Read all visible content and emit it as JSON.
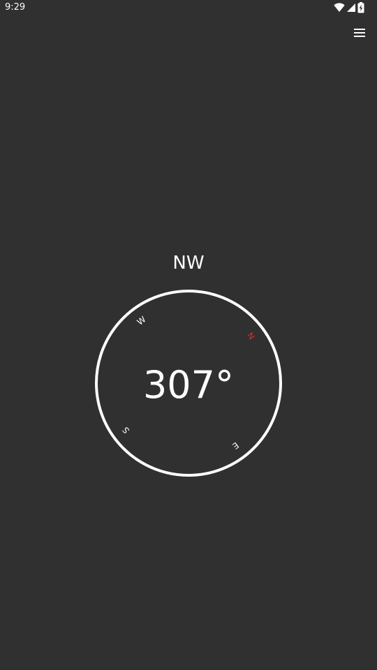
{
  "status_bar": {
    "time": "9:29",
    "icons": [
      "wifi-icon",
      "cellular-signal-icon",
      "battery-charging-icon"
    ]
  },
  "toolbar": {
    "menu_icon": "hamburger-menu-icon"
  },
  "compass": {
    "direction": "NW",
    "heading": "307°",
    "heading_value": 307,
    "cardinals": {
      "n": "N",
      "e": "E",
      "s": "S",
      "w": "W"
    },
    "north_color": "#d32f2f",
    "ring_color": "#ffffff",
    "background": "#303030"
  }
}
